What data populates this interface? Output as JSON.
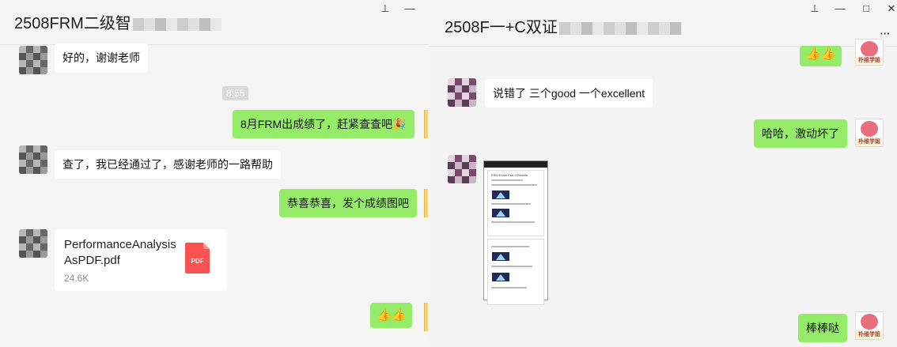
{
  "left_window": {
    "title": "2508FRM二级智",
    "pin_icon": "pin-icon",
    "minimize_icon": "minimize-icon",
    "messages": [
      {
        "side": "in",
        "text": "好的，谢谢老师"
      },
      {
        "time": "8:55"
      },
      {
        "side": "out",
        "text": "8月FRM出成绩了，赶紧查查吧🎉"
      },
      {
        "side": "in",
        "text": "查了，我已经通过了，感谢老师的一路帮助"
      },
      {
        "side": "out",
        "text": "恭喜恭喜，发个成绩图吧"
      },
      {
        "side": "in",
        "file": {
          "name": "PerformanceAnalysisAsPDF.pdf",
          "size": "24.6K",
          "icon_label": "PDF"
        }
      },
      {
        "side": "out",
        "text": "👍👍"
      }
    ]
  },
  "right_window": {
    "title": "2508F一+C双证",
    "pin_icon": "pin-icon",
    "minimize_icon": "minimize-icon",
    "maximize_icon": "maximize-icon",
    "close_icon": "close-icon",
    "more_icon": "more-icon",
    "messages": [
      {
        "side": "out",
        "text": "👍👍"
      },
      {
        "side": "in",
        "text": "说错了 三个good 一个excellent"
      },
      {
        "side": "out",
        "text": "哈哈，激动坏了"
      },
      {
        "side": "in",
        "image": {
          "heading": "FRM Exam Part II Results"
        }
      },
      {
        "side": "out",
        "text": "棒棒哒"
      }
    ],
    "self_avatar_caption": "朴维学姐"
  }
}
